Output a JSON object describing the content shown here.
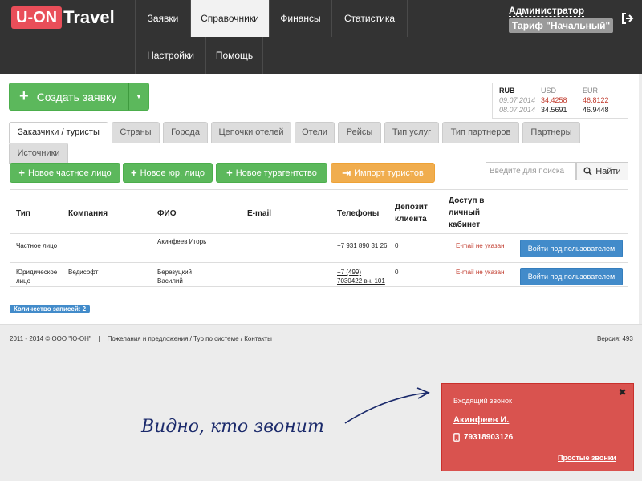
{
  "header": {
    "logo_brand": "U-ON",
    "logo_rest": "Travel",
    "nav": [
      "Заявки",
      "Справочники",
      "Финансы",
      "Статистика",
      "Настройки",
      "Помощь"
    ],
    "user": "Администратор",
    "tariff": "Тариф \"Начальный\""
  },
  "toolbar": {
    "create_label": "Создать заявку"
  },
  "rates": {
    "headers": [
      "RUB",
      "USD",
      "EUR"
    ],
    "rows": [
      [
        "09.07.2014",
        "34.4258",
        "46.8122"
      ],
      [
        "08.07.2014",
        "34.5691",
        "46.9448"
      ]
    ]
  },
  "tabs": [
    "Заказчики / туристы",
    "Страны",
    "Города",
    "Цепочки отелей",
    "Отели",
    "Рейсы",
    "Тип услуг",
    "Тип партнеров",
    "Партнеры",
    "Источники"
  ],
  "actions": {
    "private": "Новое частное лицо",
    "legal": "Новое юр. лицо",
    "agency": "Новое турагентство",
    "import": "Импорт туристов",
    "search_placeholder": "Введите для поиска",
    "search_button": "Найти"
  },
  "table": {
    "headers": [
      "Тип",
      "Компания",
      "ФИО",
      "E-mail",
      "Телефоны",
      "Депозит клиента",
      "Доступ в личный кабинет"
    ],
    "rows": [
      {
        "type": "Частное лицо",
        "company": "",
        "name": "Акинфеев Игорь",
        "email": "",
        "phone": "+7 931 890 31 26",
        "deposit": "0",
        "access": "E-mail не указан",
        "button": "Войти под пользователем"
      },
      {
        "type": "Юридическое лицо",
        "company": "Ведисофт",
        "name": "Березуцкий Василий",
        "email": "",
        "phone": "+7 (499) 7030422 вн. 101",
        "deposit": "0",
        "access": "E-mail не указан",
        "button": "Войти под пользователем"
      }
    ],
    "count": "Количество записей: 2"
  },
  "footer": {
    "copyright": "2011 - 2014 © ООО \"Ю-ОН\"",
    "links": [
      "Пожелания и предложения",
      "Тур по системе",
      "Контакты"
    ],
    "version": "Версия: 493"
  },
  "callout": "Видно, кто звонит",
  "popup": {
    "title": "Входящий звонок",
    "name": "Акинфеев И.",
    "phone": "79318903126",
    "link": "Простые звонки"
  },
  "colors": {
    "brand": "#e94e59",
    "topbar": "#333333",
    "green": "#5cb85c",
    "orange": "#f0ad4e",
    "blue": "#428bca",
    "popup": "#d9534f"
  }
}
